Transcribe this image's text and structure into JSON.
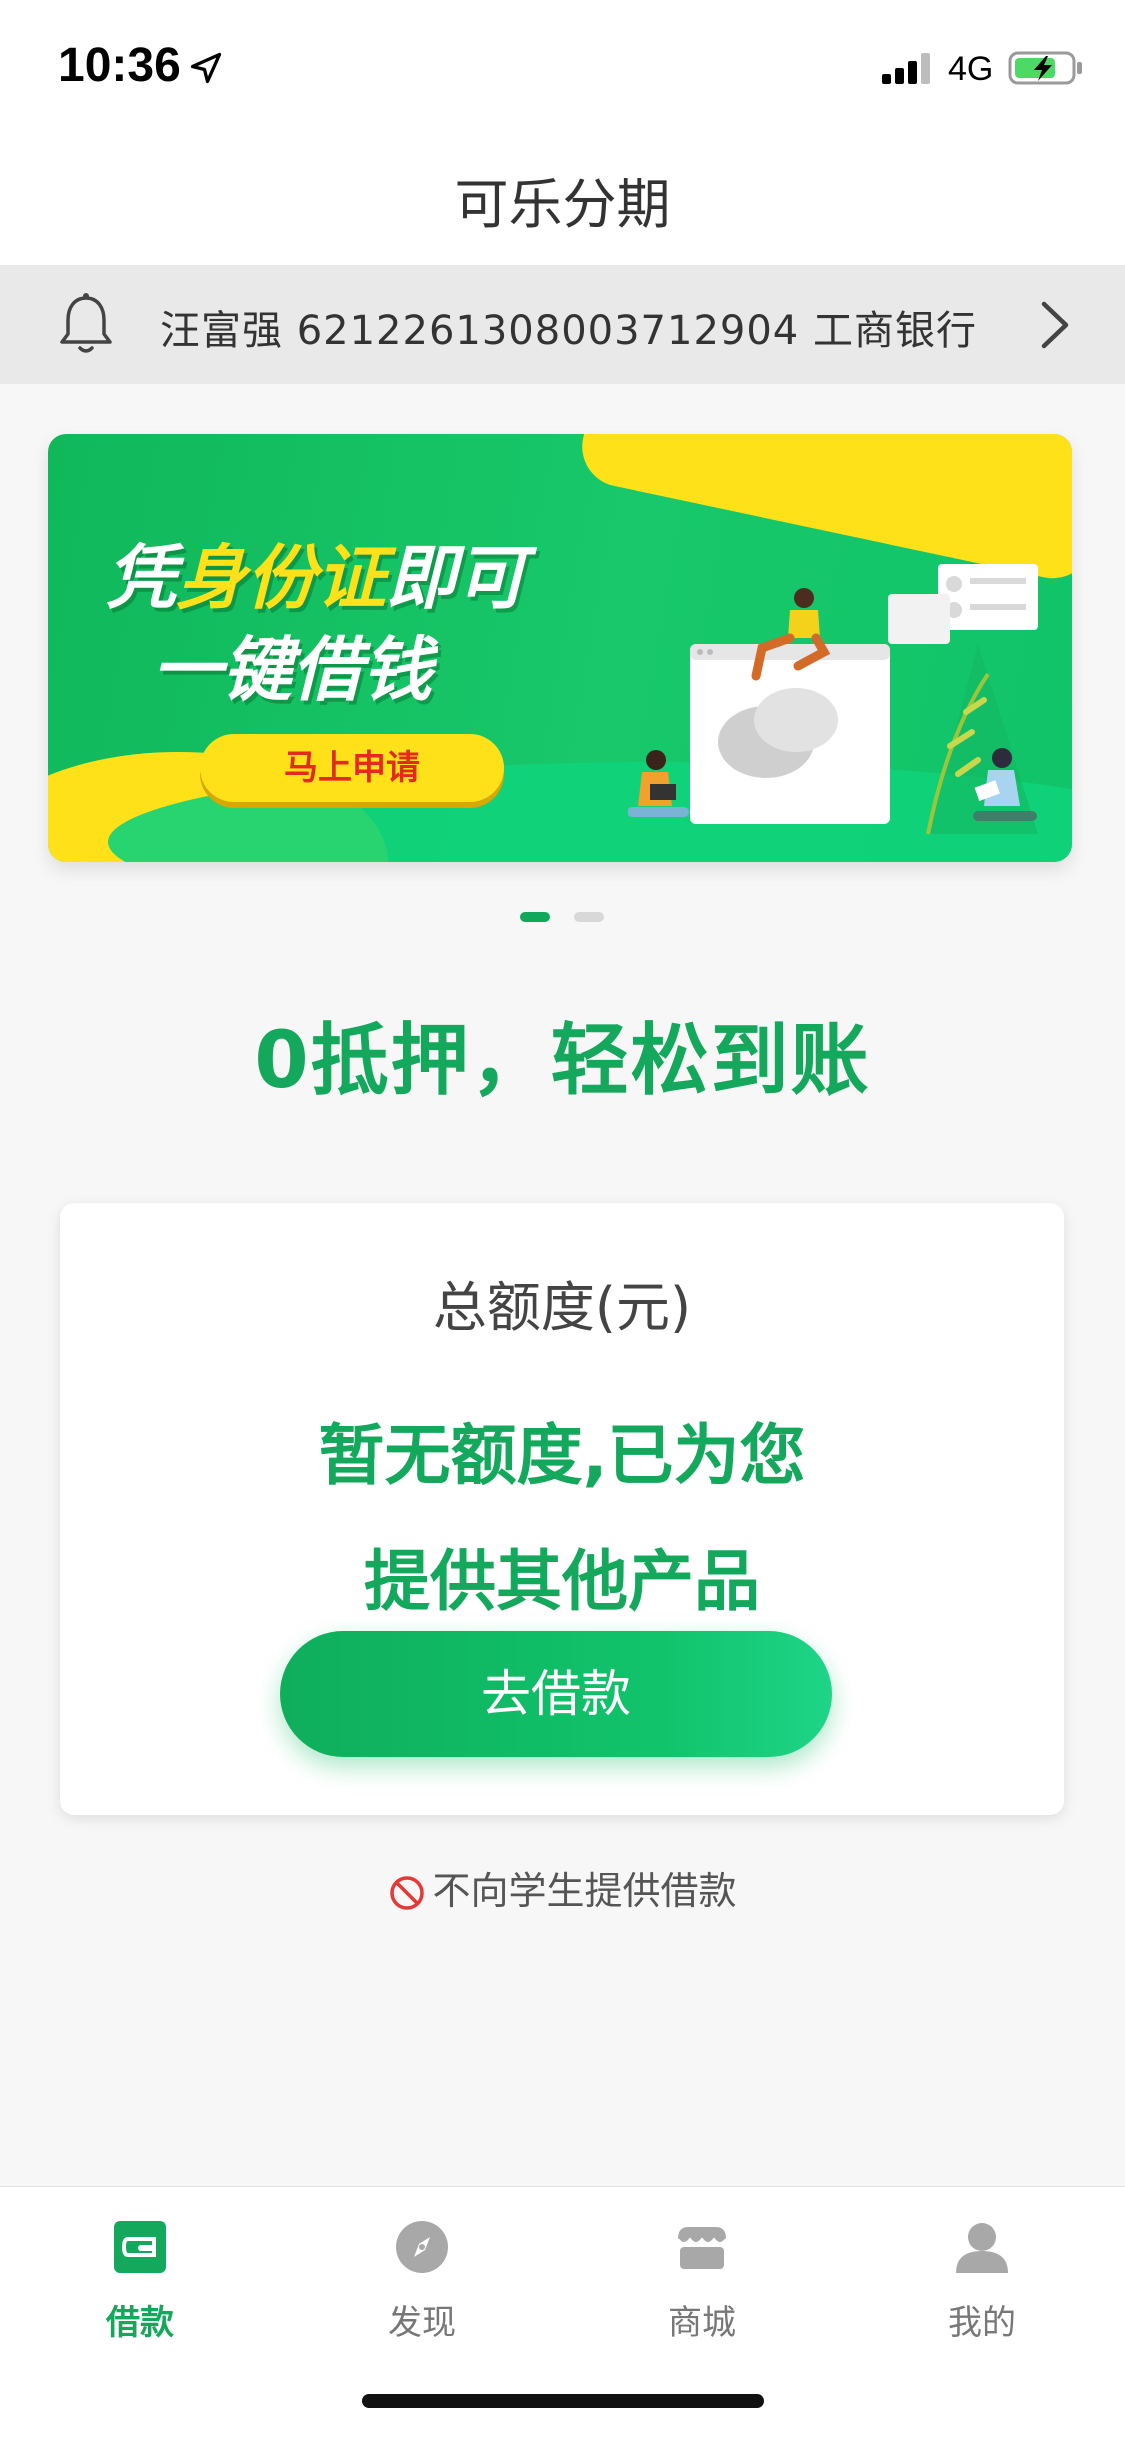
{
  "status_bar": {
    "time": "10:36",
    "network": "4G"
  },
  "nav": {
    "title": "可乐分期"
  },
  "notice": {
    "text": "汪富强 6212261308003712904 工商银行"
  },
  "banner": {
    "headline_prefix": "凭",
    "headline_highlight": "身份证",
    "headline_suffix": "即可",
    "subline": "一键借钱",
    "apply_label": "马上申请"
  },
  "slogan": "0抵押，轻松到账",
  "credit": {
    "title": "总额度(元)",
    "status_line1": "暂无额度,已为您",
    "status_line2": "提供其他产品",
    "borrow_label": "去借款"
  },
  "student_notice": "不向学生提供借款",
  "tabs": [
    {
      "label": "借款",
      "icon": "wallet-icon",
      "active": true
    },
    {
      "label": "发现",
      "icon": "compass-icon",
      "active": false
    },
    {
      "label": "商城",
      "icon": "store-icon",
      "active": false
    },
    {
      "label": "我的",
      "icon": "user-icon",
      "active": false
    }
  ],
  "colors": {
    "accent": "#14a85c",
    "banner_yellow": "#ffe11a",
    "apply_text": "#e32b1c"
  }
}
